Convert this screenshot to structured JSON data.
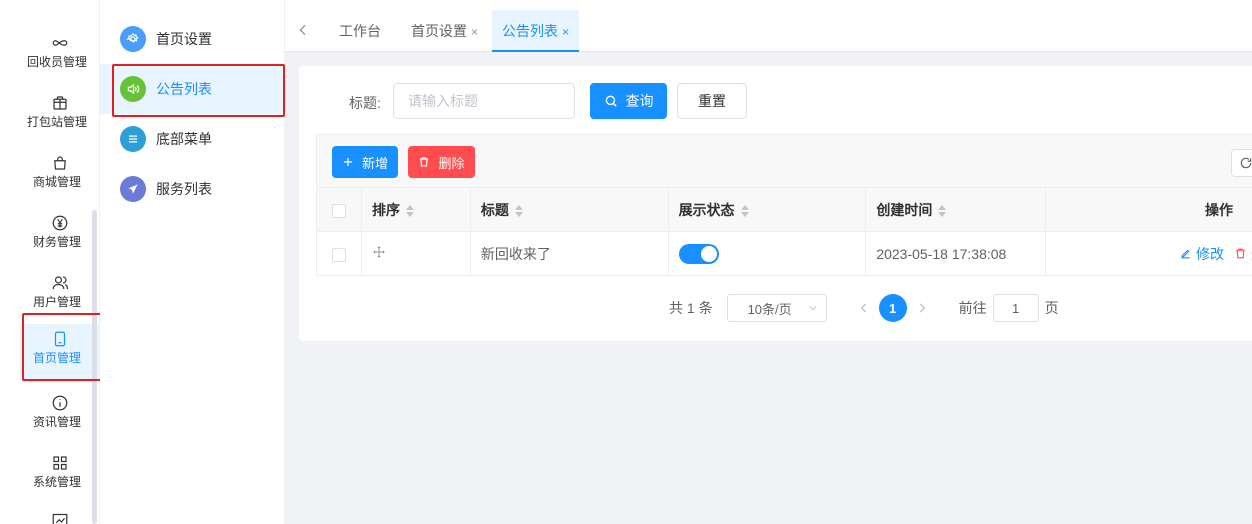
{
  "nav": {
    "items": [
      {
        "label": "回收员管理",
        "icon": "infinity-icon"
      },
      {
        "label": "打包站管理",
        "icon": "package-icon"
      },
      {
        "label": "商城管理",
        "icon": "shopping-bag-icon"
      },
      {
        "label": "财务管理",
        "icon": "yen-icon"
      },
      {
        "label": "用户管理",
        "icon": "users-icon"
      },
      {
        "label": "首页管理",
        "icon": "tablet-icon",
        "active": true
      },
      {
        "label": "资讯管理",
        "icon": "info-icon"
      },
      {
        "label": "系统管理",
        "icon": "grid-icon"
      }
    ]
  },
  "submenu": {
    "items": [
      {
        "label": "首页设置",
        "icon": "settings-icon",
        "color": "#4a9df8"
      },
      {
        "label": "公告列表",
        "icon": "speaker-icon",
        "color": "#67c23a",
        "active": true
      },
      {
        "label": "底部菜单",
        "icon": "list-icon",
        "color": "#2d9fd8"
      },
      {
        "label": "服务列表",
        "icon": "send-icon",
        "color": "#6b7bd6"
      }
    ]
  },
  "tabs": {
    "items": [
      {
        "label": "工作台",
        "closable": false
      },
      {
        "label": "首页设置",
        "closable": true
      },
      {
        "label": "公告列表",
        "closable": true,
        "active": true
      }
    ],
    "close_glyph": "×"
  },
  "search": {
    "label": "标题:",
    "placeholder": "请输入标题",
    "query_label": "查询",
    "reset_label": "重置"
  },
  "toolbar": {
    "add_label": "新增",
    "delete_label": "删除"
  },
  "table": {
    "columns": [
      "排序",
      "标题",
      "展示状态",
      "创建时间",
      "操作"
    ],
    "rows": [
      {
        "title": "新回收来了",
        "status_on": true,
        "created": "2023-05-18 17:38:08",
        "edit_label": "修改",
        "delete_label": "删"
      }
    ]
  },
  "pagination": {
    "total": "共 1 条",
    "page_size": "10条/页",
    "current_page": "1",
    "goto_label": "前往",
    "goto_value": "1",
    "page_suffix": "页"
  },
  "colors": {
    "primary": "#1890ff",
    "danger": "#ff4d4f",
    "highlight": "#e02020"
  }
}
